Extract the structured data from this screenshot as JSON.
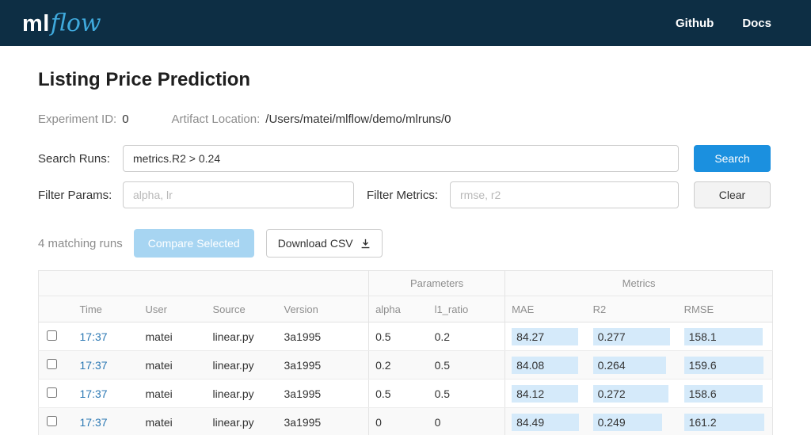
{
  "header": {
    "logo_ml": "ml",
    "logo_flow": "flow",
    "nav": [
      {
        "label": "Github"
      },
      {
        "label": "Docs"
      }
    ]
  },
  "page": {
    "title": "Listing Price Prediction",
    "experiment_id_label": "Experiment ID:",
    "experiment_id_value": "0",
    "artifact_location_label": "Artifact Location:",
    "artifact_location_value": "/Users/matei/mlflow/demo/mlruns/0"
  },
  "search": {
    "label": "Search Runs:",
    "value": "metrics.R2 > 0.24",
    "button_label": "Search"
  },
  "filters": {
    "params_label": "Filter Params:",
    "params_placeholder": "alpha, lr",
    "metrics_label": "Filter Metrics:",
    "metrics_placeholder": "rmse, r2",
    "clear_button_label": "Clear"
  },
  "actions": {
    "matching_runs_text": "4 matching runs",
    "compare_button_label": "Compare Selected",
    "download_button_label": "Download CSV",
    "download_icon": "download-icon"
  },
  "table": {
    "group_headers": {
      "parameters": "Parameters",
      "metrics": "Metrics"
    },
    "columns": [
      "Time",
      "User",
      "Source",
      "Version",
      "alpha",
      "l1_ratio",
      "MAE",
      "R2",
      "RMSE"
    ],
    "rows": [
      {
        "time": "17:37",
        "user": "matei",
        "source": "linear.py",
        "version": "3a1995",
        "alpha": "0.5",
        "l1_ratio": "0.2",
        "mae": "84.27",
        "r2": "0.277",
        "rmse": "158.1"
      },
      {
        "time": "17:37",
        "user": "matei",
        "source": "linear.py",
        "version": "3a1995",
        "alpha": "0.2",
        "l1_ratio": "0.5",
        "mae": "84.08",
        "r2": "0.264",
        "rmse": "159.6"
      },
      {
        "time": "17:37",
        "user": "matei",
        "source": "linear.py",
        "version": "3a1995",
        "alpha": "0.5",
        "l1_ratio": "0.5",
        "mae": "84.12",
        "r2": "0.272",
        "rmse": "158.6"
      },
      {
        "time": "17:37",
        "user": "matei",
        "source": "linear.py",
        "version": "3a1995",
        "alpha": "0",
        "l1_ratio": "0",
        "mae": "84.49",
        "r2": "0.249",
        "rmse": "161.2"
      }
    ]
  },
  "colors": {
    "header-bg": "#0d2e44",
    "logo-accent": "#3fa9dc",
    "accent": "#1b90df",
    "disabled-blue": "#a7d5f2",
    "link": "#2d79b4",
    "bar": "#d5eafa"
  }
}
